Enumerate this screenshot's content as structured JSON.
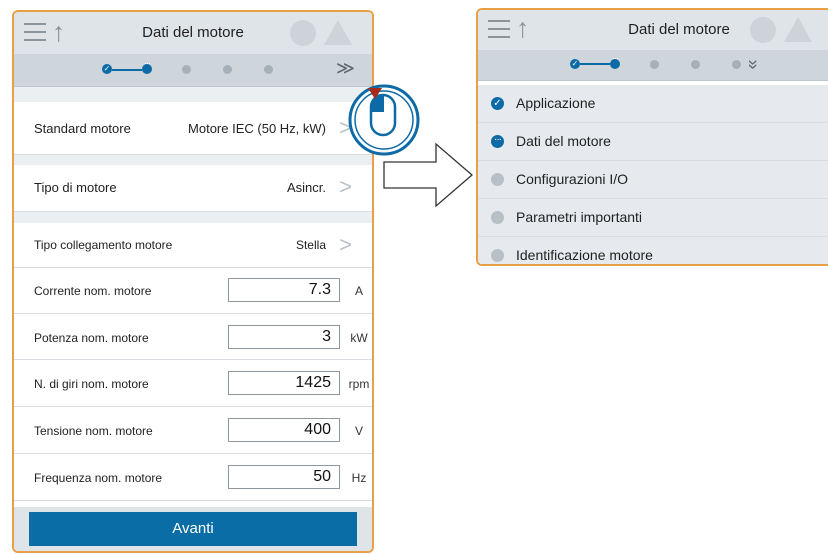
{
  "left_screen": {
    "header": {
      "title": "Dati del motore"
    },
    "rows": {
      "standard_motore": {
        "label": "Standard motore",
        "value": "Motore IEC (50 Hz, kW)"
      },
      "tipo_motore": {
        "label": "Tipo di motore",
        "value": "Asincr."
      },
      "tipo_collegamento": {
        "label": "Tipo collegamento motore",
        "value": "Stella"
      }
    },
    "fields": [
      {
        "label": "Corrente nom. motore",
        "value": "7.3",
        "unit": "A"
      },
      {
        "label": "Potenza nom. motore",
        "value": "3",
        "unit": "kW"
      },
      {
        "label": "N. di giri nom. motore",
        "value": "1425",
        "unit": "rpm"
      },
      {
        "label": "Tensione nom. motore",
        "value": "400",
        "unit": "V"
      },
      {
        "label": "Frequenza nom. motore",
        "value": "50",
        "unit": "Hz"
      }
    ],
    "footer": {
      "next_label": "Avanti"
    }
  },
  "right_screen": {
    "header": {
      "title": "Dati del motore"
    },
    "steps": [
      {
        "label": "Applicazione",
        "state": "done"
      },
      {
        "label": "Dati del motore",
        "state": "current"
      },
      {
        "label": "Configurazioni I/O",
        "state": "todo"
      },
      {
        "label": "Parametri importanti",
        "state": "todo"
      },
      {
        "label": "Identificazione motore",
        "state": "todo"
      }
    ]
  },
  "icons": {
    "menu": "hamburger-icon",
    "up": "up-arrow-icon",
    "expand": "double-chevron-down-icon",
    "forward": "chevron-right-icon",
    "mouse": "mouse-click-icon",
    "transition": "right-arrow-icon"
  },
  "colors": {
    "accent": "#0a6da5",
    "frame": "#e8a046",
    "header": "#dfe4e8"
  }
}
